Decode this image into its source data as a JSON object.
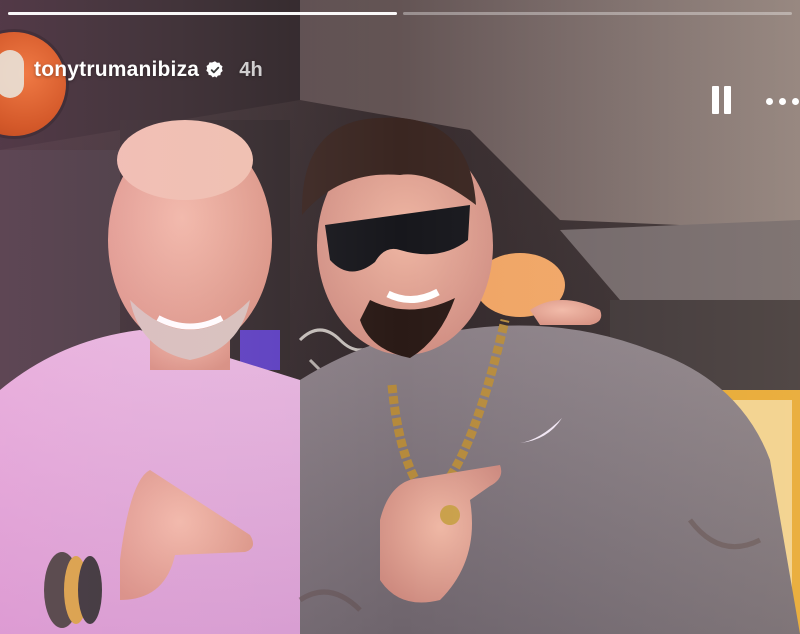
{
  "story": {
    "username": "tonytrumanibiza",
    "time_ago": "4h",
    "icons": {
      "verified": "verified-badge-icon",
      "pause": "pause-icon",
      "more": "more-options-icon"
    },
    "progress": [
      1.0,
      0.0
    ]
  }
}
